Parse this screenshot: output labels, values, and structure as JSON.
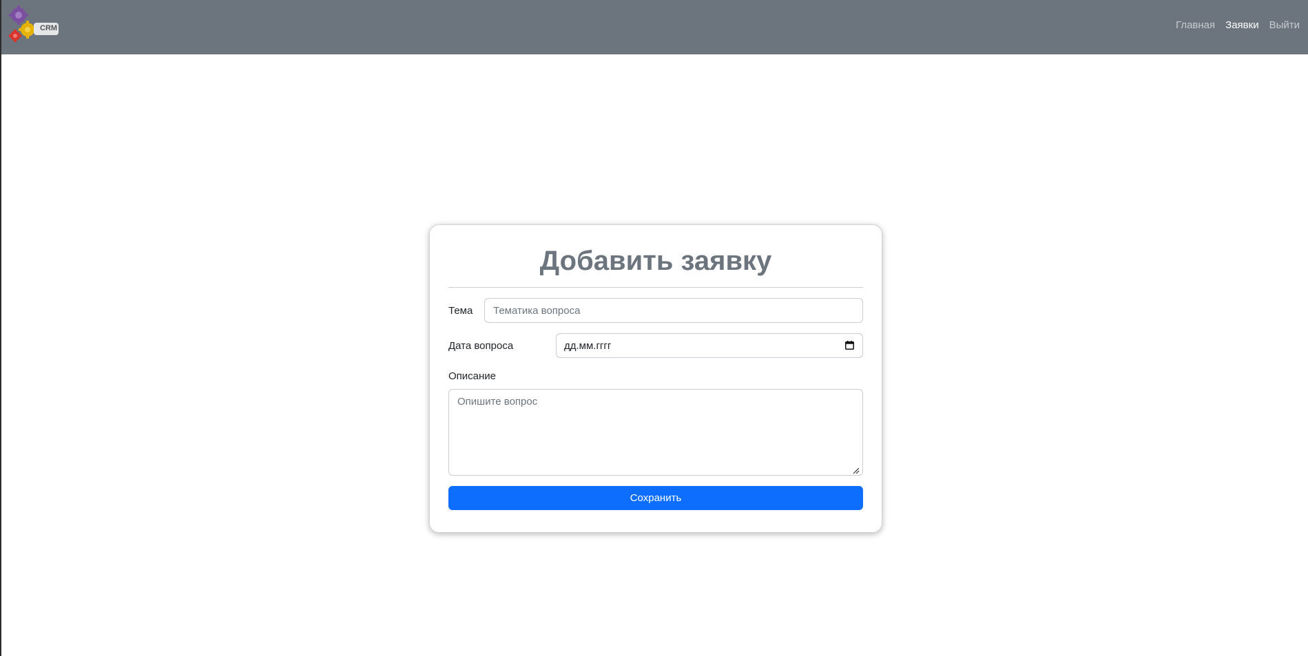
{
  "header": {
    "logo_badge": "CRM",
    "nav": [
      {
        "label": "Главная",
        "active": false
      },
      {
        "label": "Заявки",
        "active": true
      },
      {
        "label": "Выйти",
        "active": false
      }
    ]
  },
  "form": {
    "title": "Добавить заявку",
    "topic_label": "Тема",
    "topic_placeholder": "Тематика вопроса",
    "date_label": "Дата вопроса",
    "date_value": "дд.мм.гггг",
    "description_label": "Описание",
    "description_placeholder": "Опишите вопрос",
    "save_label": "Сохранить"
  },
  "colors": {
    "navbar_bg": "#6c757d",
    "title_color": "#6c757d",
    "primary_button": "#0d6efd",
    "active_nav": "#ffffff",
    "inactive_nav": "#c6cbd0"
  },
  "icons": {
    "logo": "gears-logo-icon",
    "date_picker": "calendar-icon"
  }
}
